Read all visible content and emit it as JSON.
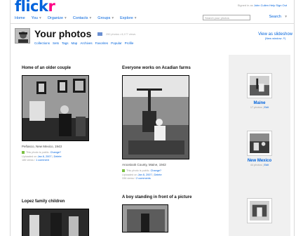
{
  "topbar": {
    "logo_main": "flick",
    "logo_r": "r",
    "nav": [
      {
        "label": "Home",
        "dd": ""
      },
      {
        "label": "You",
        "dd": "▾"
      },
      {
        "label": "Organize",
        "dd": "▾"
      },
      {
        "label": "Contacts",
        "dd": "▾"
      },
      {
        "label": "Groups",
        "dd": "▾"
      },
      {
        "label": "Explore",
        "dd": "▾"
      }
    ],
    "signed_in_prefix": "Signed in as",
    "signed_in_user": "John Culien",
    "signed_in_links": [
      "Help",
      "Sign Out"
    ],
    "search_placeholder": "Search your photos",
    "search_label": "Search",
    "search_dd": "▾"
  },
  "header": {
    "title": "Your photos",
    "count": "250 photos • 8,177 views",
    "subnav": [
      "Collections",
      "Sets",
      "Tags",
      "Map",
      "Archives",
      "Favorites",
      "Popular",
      "Profile"
    ],
    "slideshow": "View as slideshow",
    "slideshow_sub": "(New window ↗)"
  },
  "photos": [
    {
      "title": "Home of an older couple",
      "desc": "Peñasco, New Mexico, 1943",
      "public_text": "This photo is public.",
      "change": "Change?",
      "uploaded_prefix": "Uploaded on",
      "uploaded_date": "Jan 8, 2007",
      "delete": "Delete",
      "views": "186 views",
      "comments": "1 comment"
    },
    {
      "title": "Everyone works on Acadian farms",
      "desc": "Aroostook County, Maine, 1942",
      "public_text": "This photo is public.",
      "change": "Change?",
      "uploaded_prefix": "Uploaded on",
      "uploaded_date": "Jan 8, 2007",
      "delete": "Delete",
      "views": "336 views",
      "comments": "2 comments"
    },
    {
      "title": "Lopez family children"
    },
    {
      "title": "A boy standing in front of a picture"
    }
  ],
  "sets": [
    {
      "name": "Maine",
      "count": "17 photos",
      "edit": "Edit"
    },
    {
      "name": "New Mexico",
      "count": "44 photos",
      "edit": "Edit"
    }
  ]
}
